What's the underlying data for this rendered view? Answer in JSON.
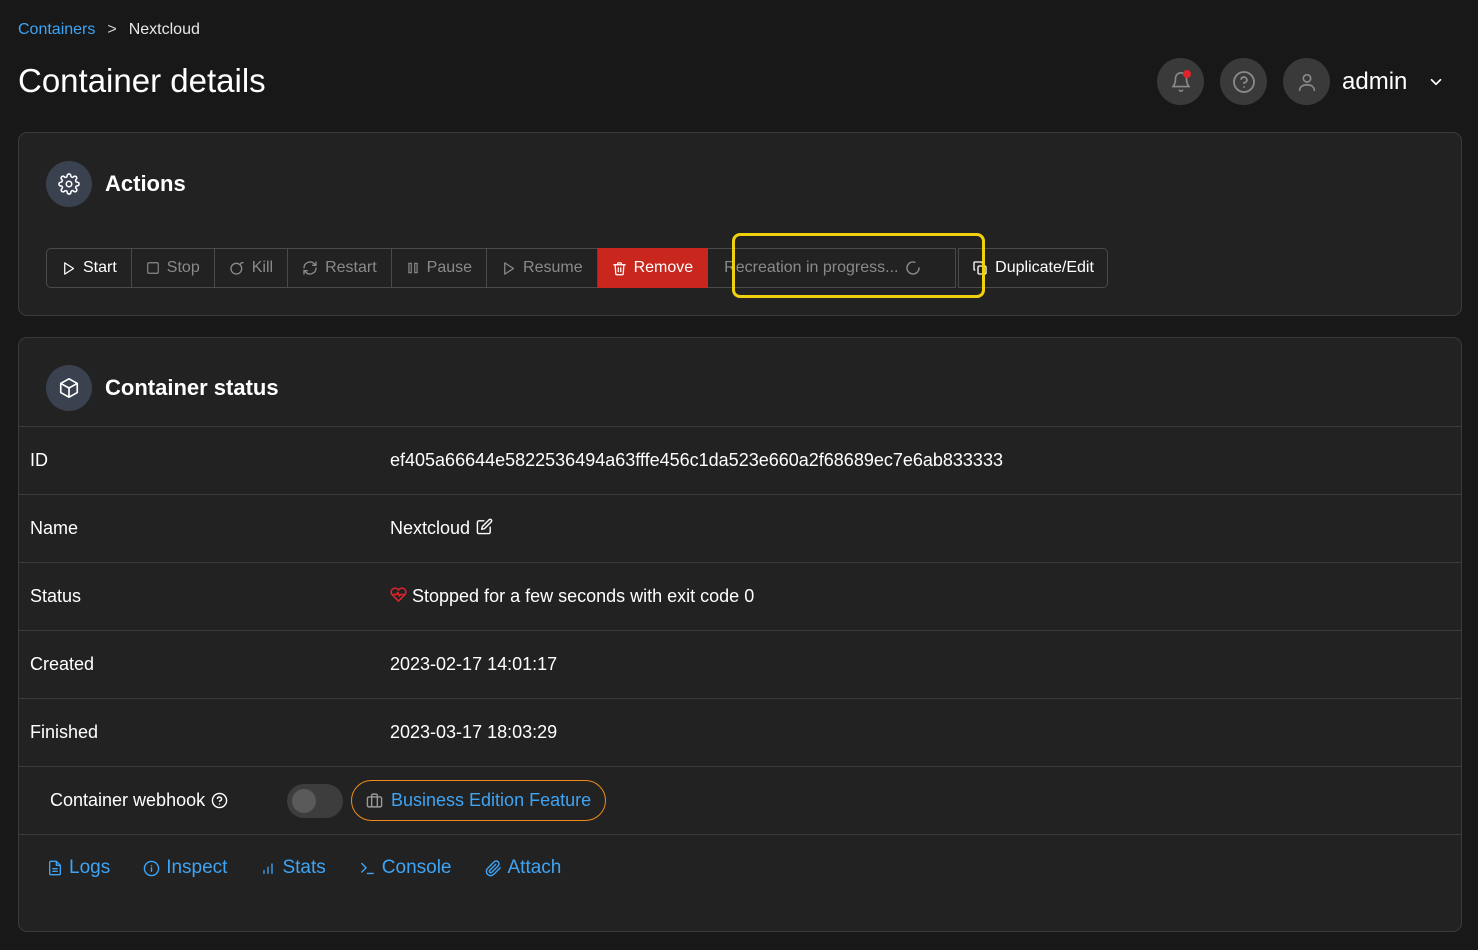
{
  "breadcrumb": {
    "parent": "Containers",
    "separator": ">",
    "current": "Nextcloud"
  },
  "page": {
    "title": "Container details"
  },
  "header": {
    "user": "admin"
  },
  "actions": {
    "title": "Actions",
    "buttons": {
      "start": "Start",
      "stop": "Stop",
      "kill": "Kill",
      "restart": "Restart",
      "pause": "Pause",
      "resume": "Resume",
      "remove": "Remove",
      "recreate": "Recreation in progress...",
      "duplicate": "Duplicate/Edit"
    }
  },
  "status": {
    "title": "Container status",
    "rows": [
      {
        "label": "ID",
        "value": "ef405a66644e5822536494a63fffe456c1da523e660a2f68689ec7e6ab833333"
      },
      {
        "label": "Name",
        "value": "Nextcloud"
      },
      {
        "label": "Status",
        "value": "Stopped for a few seconds with exit code 0"
      },
      {
        "label": "Created",
        "value": "2023-02-17 14:01:17"
      },
      {
        "label": "Finished",
        "value": "2023-03-17 18:03:29"
      }
    ],
    "webhook_label": "Container webhook",
    "webhook_enabled": false,
    "business_badge": "Business Edition Feature",
    "links": {
      "logs": "Logs",
      "inspect": "Inspect",
      "stats": "Stats",
      "console": "Console",
      "attach": "Attach"
    }
  },
  "colors": {
    "accent": "#3ea4f5",
    "danger": "#c9271d",
    "highlight": "#f1d00e",
    "business_border": "#f08c1a",
    "background": "#181818",
    "card": "#222222"
  }
}
